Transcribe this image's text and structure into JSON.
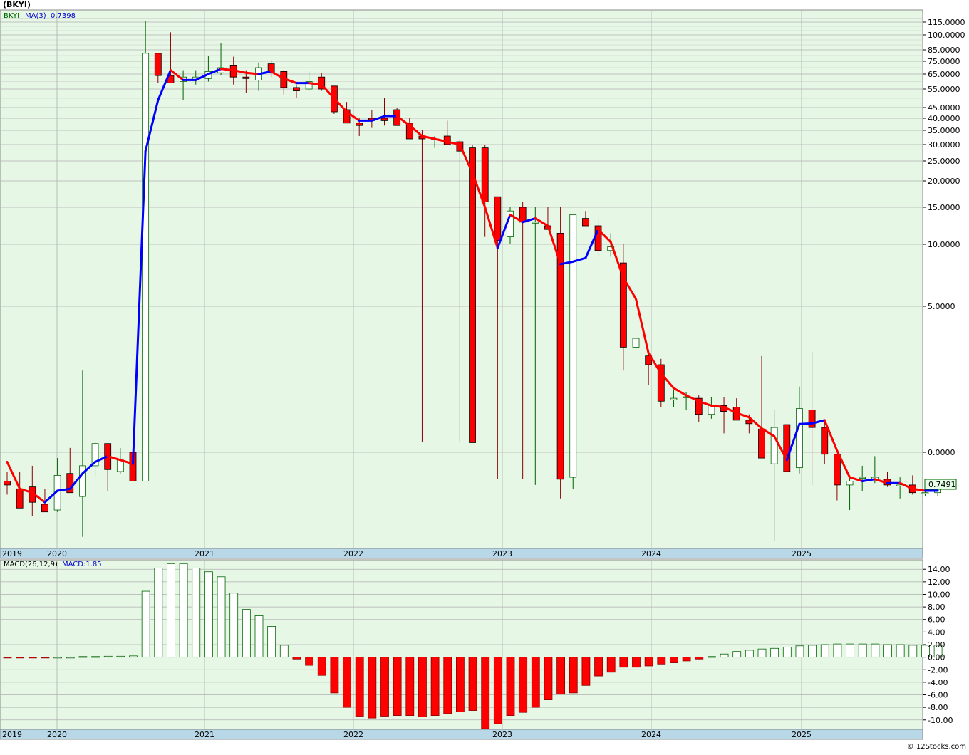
{
  "header": {
    "ticker_title": "(BKYI)",
    "symbol": "BKYI",
    "ma_label": "MA(3)",
    "ma_value": "0.7398",
    "last_price": "0.7491"
  },
  "macd_header": {
    "label": "MACD(26,12,9)",
    "value_label": "MACD:1.85"
  },
  "footer": {
    "copyright": "© 12Stocks.com"
  },
  "colors": {
    "up_border": "#006400",
    "down_fill": "#ff0000",
    "ma_up": "#0000ff",
    "ma_down": "#ff0000",
    "price_bg": "#e6f7e6",
    "timeline_bg": "#b8d8e8"
  },
  "chart_data": [
    {
      "type": "candlestick",
      "title": "(BKYI)",
      "scale": "custom (log-like, tick labels as printed)",
      "y_tick_labels": [
        "115.0000",
        "100.0000",
        "85.0000",
        "75.0000",
        "65.0000",
        "55.0000",
        "45.0000",
        "40.0000",
        "35.0000",
        "30.0000",
        "25.0000",
        "20.0000",
        "15.0000",
        "10.0000",
        "5.0000",
        "0.0000"
      ],
      "year_labels": [
        "2019",
        "2020",
        "2021",
        "2022",
        "2023",
        "2024",
        "2025"
      ],
      "grid": true,
      "ohlc": [
        {
          "o": -0.75,
          "h": -0.5,
          "l": -1.1,
          "c": -0.85,
          "ma": -0.25
        },
        {
          "o": -0.95,
          "h": -0.5,
          "l": -1.2,
          "c": -1.45,
          "ma": -0.95
        },
        {
          "o": -0.9,
          "h": -0.35,
          "l": -1.65,
          "c": -1.3,
          "ma": -1.05
        },
        {
          "o": -1.35,
          "h": -0.95,
          "l": -1.55,
          "c": -1.55,
          "ma": -1.3
        },
        {
          "o": -1.5,
          "h": -0.15,
          "l": -1.55,
          "c": -0.6,
          "ma": -1.0
        },
        {
          "o": -0.55,
          "h": 0.15,
          "l": -0.7,
          "c": -1.05,
          "ma": -0.95
        },
        {
          "o": -1.15,
          "h": 2.8,
          "l": -2.2,
          "c": -0.35,
          "ma": -0.55
        },
        {
          "o": -0.35,
          "h": 0.35,
          "l": -0.65,
          "c": 0.3,
          "ma": -0.25
        },
        {
          "o": 0.3,
          "h": 0.3,
          "l": -1.0,
          "c": -0.45,
          "ma": -0.1
        },
        {
          "o": -0.5,
          "h": 0.15,
          "l": -0.55,
          "c": -0.2,
          "ma": -0.2
        },
        {
          "o": 0.0,
          "h": 1.2,
          "l": -1.15,
          "c": -0.75,
          "ma": -0.3
        },
        {
          "o": -0.75,
          "h": 116,
          "l": -0.75,
          "c": 82,
          "ma": 28
        },
        {
          "o": 82,
          "h": 82,
          "l": 59,
          "c": 64,
          "ma": 49
        },
        {
          "o": 64,
          "h": 103,
          "l": 60,
          "c": 59,
          "ma": 68
        },
        {
          "o": 60,
          "h": 68,
          "l": 49,
          "c": 63,
          "ma": 61
        },
        {
          "o": 61,
          "h": 68,
          "l": 58,
          "c": 63,
          "ma": 61
        },
        {
          "o": 62,
          "h": 80,
          "l": 60,
          "c": 67,
          "ma": 65
        },
        {
          "o": 66,
          "h": 92,
          "l": 64,
          "c": 70,
          "ma": 69
        },
        {
          "o": 72,
          "h": 79,
          "l": 58,
          "c": 63,
          "ma": 68
        },
        {
          "o": 63,
          "h": 68,
          "l": 53,
          "c": 62,
          "ma": 66
        },
        {
          "o": 61,
          "h": 74,
          "l": 54,
          "c": 70,
          "ma": 65
        },
        {
          "o": 73,
          "h": 76,
          "l": 63,
          "c": 66,
          "ma": 67
        },
        {
          "o": 67,
          "h": 68,
          "l": 52,
          "c": 56,
          "ma": 62
        },
        {
          "o": 56,
          "h": 58,
          "l": 50,
          "c": 54,
          "ma": 59
        },
        {
          "o": 55,
          "h": 67,
          "l": 54,
          "c": 60,
          "ma": 59
        },
        {
          "o": 63,
          "h": 66,
          "l": 54,
          "c": 55,
          "ma": 58
        },
        {
          "o": 57,
          "h": 57,
          "l": 42,
          "c": 43,
          "ma": 50
        },
        {
          "o": 44,
          "h": 48,
          "l": 38,
          "c": 38,
          "ma": 43
        },
        {
          "o": 38,
          "h": 40,
          "l": 33,
          "c": 37,
          "ma": 39
        },
        {
          "o": 40,
          "h": 44,
          "l": 36,
          "c": 39,
          "ma": 39
        },
        {
          "o": 40,
          "h": 50,
          "l": 37,
          "c": 39,
          "ma": 41
        },
        {
          "o": 44,
          "h": 45,
          "l": 37,
          "c": 37,
          "ma": 41
        },
        {
          "o": 38,
          "h": 40,
          "l": 32,
          "c": 32,
          "ma": 37
        },
        {
          "o": 33,
          "h": 35,
          "l": 0.35,
          "c": 32,
          "ma": 33
        },
        {
          "o": 32,
          "h": 33,
          "l": 29,
          "c": 32,
          "ma": 32
        },
        {
          "o": 33,
          "h": 39,
          "l": 30,
          "c": 30,
          "ma": 31
        },
        {
          "o": 31,
          "h": 32,
          "l": 0.35,
          "c": 28,
          "ma": 30
        },
        {
          "o": 29,
          "h": 30,
          "l": 0.33,
          "c": 0.33,
          "ma": 22
        },
        {
          "o": 29,
          "h": 30,
          "l": 11,
          "c": 16,
          "ma": 15
        },
        {
          "o": 17,
          "h": 17,
          "l": -0.7,
          "c": 10.5,
          "ma": 9.7
        },
        {
          "o": 11,
          "h": 15,
          "l": 10,
          "c": 14.5,
          "ma": 14
        },
        {
          "o": 15,
          "h": 16,
          "l": -0.7,
          "c": 13,
          "ma": 13
        },
        {
          "o": 13,
          "h": 15,
          "l": -0.85,
          "c": 13,
          "ma": 13.5
        },
        {
          "o": 12.5,
          "h": 15,
          "l": 12,
          "c": 12,
          "ma": 12.5
        },
        {
          "o": 11.5,
          "h": 15,
          "l": -1.2,
          "c": -0.7,
          "ma": 8.4
        },
        {
          "o": -0.65,
          "h": 14,
          "l": -0.95,
          "c": 14,
          "ma": 8.6
        },
        {
          "o": 13.5,
          "h": 14.5,
          "l": 12.5,
          "c": 12.5,
          "ma": 8.9
        },
        {
          "o": 12.5,
          "h": 13.5,
          "l": 9,
          "c": 9.5,
          "ma": 12
        },
        {
          "o": 9.5,
          "h": 11.5,
          "l": 9,
          "c": 9.8,
          "ma": 10.3
        },
        {
          "o": 8.5,
          "h": 10,
          "l": 2.8,
          "c": 3.6,
          "ma": 7.3
        },
        {
          "o": 3.6,
          "h": 4.2,
          "l": 2.1,
          "c": 3.9,
          "ma": 5.6
        },
        {
          "o": 3.3,
          "h": 3.4,
          "l": 2.3,
          "c": 3.0,
          "ma": 3.4
        },
        {
          "o": 3.0,
          "h": 3.2,
          "l": 1.55,
          "c": 1.75,
          "ma": 2.7
        },
        {
          "o": 1.8,
          "h": 2.15,
          "l": 1.55,
          "c": 1.85,
          "ma": 2.2
        },
        {
          "o": 1.9,
          "h": 2.05,
          "l": 1.45,
          "c": 1.9,
          "ma": 1.95
        },
        {
          "o": 1.85,
          "h": 1.95,
          "l": 1.05,
          "c": 1.3,
          "ma": 1.75
        },
        {
          "o": 1.3,
          "h": 1.9,
          "l": 1.15,
          "c": 1.6,
          "ma": 1.6
        },
        {
          "o": 1.6,
          "h": 1.9,
          "l": 0.65,
          "c": 1.4,
          "ma": 1.55
        },
        {
          "o": 1.55,
          "h": 1.85,
          "l": 1.2,
          "c": 1.1,
          "ma": 1.35
        },
        {
          "o": 1.1,
          "h": 1.3,
          "l": 0.65,
          "c": 0.98,
          "ma": 1.2
        },
        {
          "o": 0.8,
          "h": 3.3,
          "l": -0.15,
          "c": -0.15,
          "ma": 0.82
        },
        {
          "o": -0.3,
          "h": 1.45,
          "l": -2.3,
          "c": 0.85,
          "ma": 0.55
        },
        {
          "o": 0.95,
          "h": 0.95,
          "l": -0.5,
          "c": -0.5,
          "ma": -0.2
        },
        {
          "o": -0.4,
          "h": 2.25,
          "l": -0.55,
          "c": 1.5,
          "ma": 0.97
        },
        {
          "o": 1.45,
          "h": 3.45,
          "l": -0.85,
          "c": 0.85,
          "ma": 0.99
        },
        {
          "o": 0.85,
          "h": 1.05,
          "l": -0.3,
          "c": -0.05,
          "ma": 1.1
        },
        {
          "o": -0.05,
          "h": -0.05,
          "l": -1.25,
          "c": -0.85,
          "ma": 0.05
        },
        {
          "o": -0.85,
          "h": -0.6,
          "l": -1.5,
          "c": -0.75,
          "ma": -0.65
        },
        {
          "o": -0.65,
          "h": -0.35,
          "l": -1.0,
          "c": -0.65,
          "ma": -0.75
        },
        {
          "o": -0.7,
          "h": -0.1,
          "l": -0.8,
          "c": -0.65,
          "ma": -0.7
        },
        {
          "o": -0.7,
          "h": -0.5,
          "l": -0.9,
          "c": -0.85,
          "ma": -0.8
        },
        {
          "o": -0.85,
          "h": -0.65,
          "l": -1.2,
          "c": -0.85,
          "ma": -0.8
        },
        {
          "o": -0.85,
          "h": -0.6,
          "l": -1.1,
          "c": -1.05,
          "ma": -0.95
        },
        {
          "o": -1.05,
          "h": -0.9,
          "l": -1.15,
          "c": -1.05,
          "ma": -1.0
        },
        {
          "o": -1.05,
          "h": -0.75,
          "l": -1.15,
          "c": -0.95,
          "ma": -1.0
        }
      ]
    },
    {
      "type": "bar",
      "title": "MACD(26,12,9)",
      "y_tick_labels": [
        "14.00",
        "12.00",
        "10.00",
        "8.00",
        "6.00",
        "4.00",
        "2.00",
        "0.00",
        "-2.00",
        "-4.00",
        "-6.00",
        "-8.00",
        "-10.00"
      ],
      "ylim": [
        -11.5,
        15.5
      ],
      "values": [
        -0.1,
        -0.1,
        -0.1,
        -0.1,
        0.0,
        0.0,
        0.1,
        0.1,
        0.15,
        0.15,
        0.2,
        10.5,
        14.2,
        14.9,
        14.9,
        14.2,
        13.6,
        12.8,
        10.2,
        7.6,
        6.6,
        4.9,
        1.9,
        -0.3,
        -1.3,
        -2.9,
        -5.7,
        -8.0,
        -9.4,
        -9.7,
        -9.4,
        -9.3,
        -9.3,
        -9.5,
        -9.3,
        -9.0,
        -8.7,
        -8.5,
        -11.4,
        -10.6,
        -9.3,
        -8.8,
        -8.0,
        -6.8,
        -5.9,
        -5.7,
        -4.5,
        -3.0,
        -2.4,
        -1.6,
        -1.6,
        -1.4,
        -1.1,
        -0.9,
        -0.6,
        -0.3,
        0.1,
        0.5,
        0.9,
        1.1,
        1.3,
        1.4,
        1.6,
        1.8,
        1.9,
        2.0,
        2.1,
        2.1,
        2.1,
        2.1,
        2.0,
        2.0,
        1.9,
        1.9,
        1.9
      ]
    }
  ]
}
